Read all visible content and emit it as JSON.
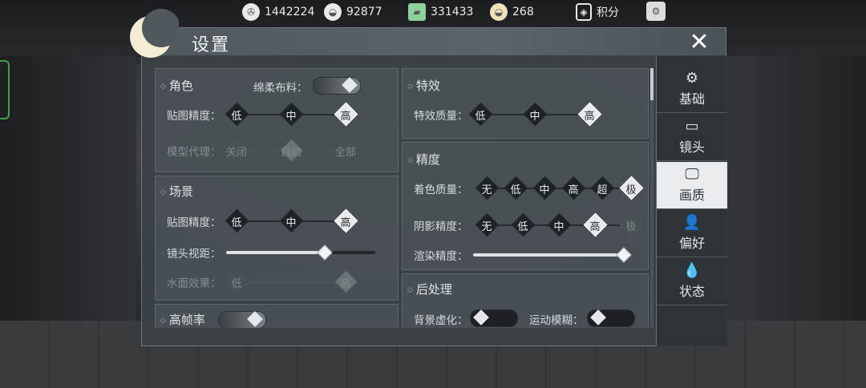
{
  "currencies": [
    {
      "icon": "film-reel-icon",
      "value": "1442224"
    },
    {
      "icon": "silver-ingot-icon",
      "value": "92877"
    },
    {
      "icon": "jade-ticket-icon",
      "value": "331433"
    },
    {
      "icon": "gold-ingot-icon",
      "value": "268"
    },
    {
      "icon": "points-shield-icon",
      "value": "积分"
    }
  ],
  "dialog": {
    "title": "设置"
  },
  "tabs": [
    {
      "label": "基础",
      "icon": "gear-icon",
      "active": false
    },
    {
      "label": "镜头",
      "icon": "camera-frame-icon",
      "active": false
    },
    {
      "label": "画质",
      "icon": "monitor-icon",
      "active": true
    },
    {
      "label": "偏好",
      "icon": "user-gear-icon",
      "active": false
    },
    {
      "label": "状态",
      "icon": "drops-icon",
      "active": false
    }
  ],
  "role": {
    "header": "角色",
    "soft_cloth_label": "绵柔布料：",
    "texture_label": "贴图精度：",
    "texture_options": [
      "低",
      "中",
      "高"
    ],
    "model_proxy_label": "模型代理：",
    "model_proxy_options": [
      "关闭",
      "自动",
      "全部"
    ]
  },
  "scene": {
    "header": "场景",
    "texture_label": "贴图精度：",
    "texture_options": [
      "低",
      "中",
      "高"
    ],
    "view_distance_label": "镜头视距：",
    "view_distance_value": 0.66,
    "water_label": "水面效果：",
    "water_options": [
      "低",
      "高"
    ]
  },
  "high_fps": {
    "header": "高帧率"
  },
  "effects": {
    "header": "特效",
    "quality_label": "特效质量：",
    "quality_options": [
      "低",
      "中",
      "高"
    ]
  },
  "precision": {
    "header": "精度",
    "shading_label": "着色质量：",
    "shading_options": [
      "无",
      "低",
      "中",
      "高",
      "超",
      "极"
    ],
    "shadow_label": "阴影精度：",
    "shadow_options": [
      "无",
      "低",
      "中",
      "高",
      "极"
    ],
    "render_label": "渲染精度：",
    "render_value": 1.0
  },
  "post": {
    "header": "后处理",
    "bg_blur_label": "背景虚化：",
    "motion_blur_label": "运动模糊："
  }
}
